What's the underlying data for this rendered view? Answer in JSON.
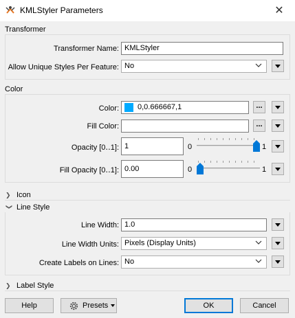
{
  "window": {
    "title": "KMLStyler Parameters",
    "close_glyph": "✕",
    "app_icon": "fme-transformer-icon"
  },
  "transformer": {
    "group_title": "Transformer",
    "name_label": "Transformer Name:",
    "name_value": "KMLStyler",
    "unique_label": "Allow Unique Styles Per Feature:",
    "unique_value": "No"
  },
  "color": {
    "group_title": "Color",
    "color_label": "Color:",
    "color_value": "0,0.666667,1",
    "swatch_color": "#00aaff",
    "fill_color_label": "Fill Color:",
    "fill_color_value": "",
    "dots_label": "...",
    "opacity_label": "Opacity [0‥1]:",
    "opacity_value": "1",
    "opacity_min": "0",
    "opacity_max": "1",
    "opacity_level": 1,
    "fill_opacity_label": "Fill Opacity [0‥1]:",
    "fill_opacity_value": "0.00",
    "fill_opacity_min": "0",
    "fill_opacity_max": "1",
    "fill_opacity_level": 0
  },
  "sections": {
    "icon": "Icon",
    "line_style": "Line Style",
    "label_style": "Label Style"
  },
  "line_style": {
    "width_label": "Line Width:",
    "width_value": "1.0",
    "units_label": "Line Width Units:",
    "units_value": "Pixels (Display Units)",
    "labels_label": "Create Labels on Lines:",
    "labels_value": "No"
  },
  "footer": {
    "help": "Help",
    "presets": "Presets",
    "ok": "OK",
    "cancel": "Cancel"
  },
  "accent_color": "#0078d7"
}
